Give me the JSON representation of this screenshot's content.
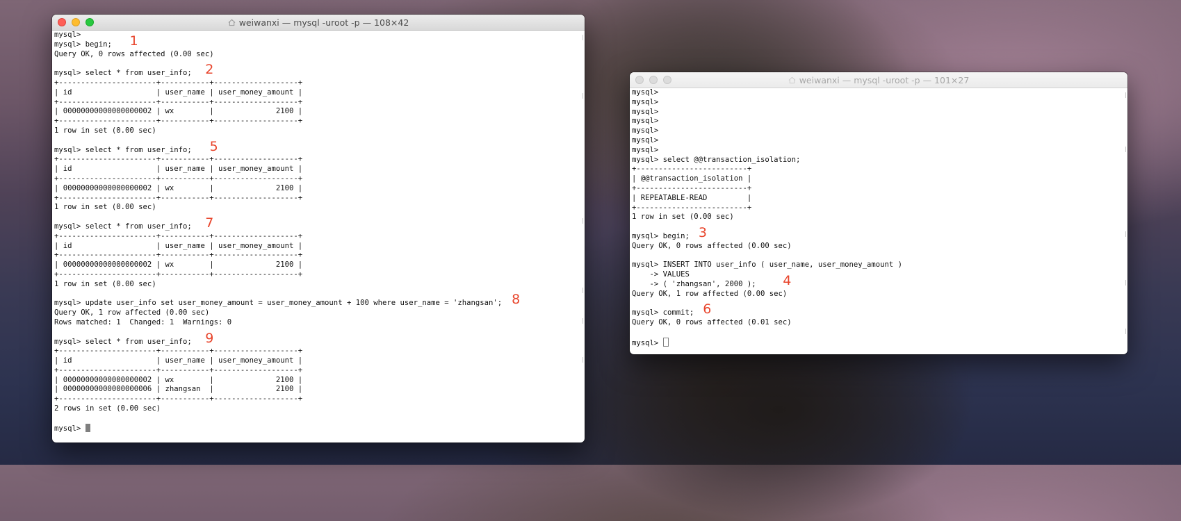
{
  "window_left": {
    "title": "weiwanxi — mysql -uroot -p — 108×42",
    "lines": [
      {
        "text": "mysql>"
      },
      {
        "text": "mysql> begin;",
        "mark": "1",
        "mark_col": 17
      },
      {
        "text": "Query OK, 0 rows affected (0.00 sec)"
      },
      {
        "text": ""
      },
      {
        "text": "mysql> select * from user_info;",
        "mark": "2",
        "mark_col": 34
      },
      {
        "text": "+----------------------+-----------+-------------------+"
      },
      {
        "text": "| id                   | user_name | user_money_amount |"
      },
      {
        "text": "+----------------------+-----------+-------------------+"
      },
      {
        "text": "| 00000000000000000002 | wx        |              2100 |"
      },
      {
        "text": "+----------------------+-----------+-------------------+"
      },
      {
        "text": "1 row in set (0.00 sec)"
      },
      {
        "text": ""
      },
      {
        "text": "mysql> select * from user_info;",
        "mark": "5",
        "mark_col": 35
      },
      {
        "text": "+----------------------+-----------+-------------------+"
      },
      {
        "text": "| id                   | user_name | user_money_amount |"
      },
      {
        "text": "+----------------------+-----------+-------------------+"
      },
      {
        "text": "| 00000000000000000002 | wx        |              2100 |"
      },
      {
        "text": "+----------------------+-----------+-------------------+"
      },
      {
        "text": "1 row in set (0.00 sec)"
      },
      {
        "text": ""
      },
      {
        "text": "mysql> select * from user_info;",
        "mark": "7",
        "mark_col": 34
      },
      {
        "text": "+----------------------+-----------+-------------------+"
      },
      {
        "text": "| id                   | user_name | user_money_amount |"
      },
      {
        "text": "+----------------------+-----------+-------------------+"
      },
      {
        "text": "| 00000000000000000002 | wx        |              2100 |"
      },
      {
        "text": "+----------------------+-----------+-------------------+"
      },
      {
        "text": "1 row in set (0.00 sec)"
      },
      {
        "text": ""
      },
      {
        "text": "mysql> update user_info set user_money_amount = user_money_amount + 100 where user_name = 'zhangsan';",
        "mark": "8",
        "mark_col": 103
      },
      {
        "text": "Query OK, 1 row affected (0.00 sec)"
      },
      {
        "text": "Rows matched: 1  Changed: 1  Warnings: 0"
      },
      {
        "text": ""
      },
      {
        "text": "mysql> select * from user_info;",
        "mark": "9",
        "mark_col": 34
      },
      {
        "text": "+----------------------+-----------+-------------------+"
      },
      {
        "text": "| id                   | user_name | user_money_amount |"
      },
      {
        "text": "+----------------------+-----------+-------------------+"
      },
      {
        "text": "| 00000000000000000002 | wx        |              2100 |"
      },
      {
        "text": "| 00000000000000000006 | zhangsan  |              2100 |"
      },
      {
        "text": "+----------------------+-----------+-------------------+"
      },
      {
        "text": "2 rows in set (0.00 sec)"
      },
      {
        "text": ""
      }
    ],
    "prompt": "mysql> "
  },
  "window_right": {
    "title": "weiwanxi — mysql -uroot -p — 101×27",
    "lines": [
      {
        "text": "mysql>"
      },
      {
        "text": "mysql>"
      },
      {
        "text": "mysql>"
      },
      {
        "text": "mysql>"
      },
      {
        "text": "mysql>"
      },
      {
        "text": "mysql>"
      },
      {
        "text": "mysql>"
      },
      {
        "text": "mysql> select @@transaction_isolation;"
      },
      {
        "text": "+-------------------------+"
      },
      {
        "text": "| @@transaction_isolation |"
      },
      {
        "text": "+-------------------------+"
      },
      {
        "text": "| REPEATABLE-READ         |"
      },
      {
        "text": "+-------------------------+"
      },
      {
        "text": "1 row in set (0.00 sec)"
      },
      {
        "text": ""
      },
      {
        "text": "mysql> begin;",
        "mark": "3",
        "mark_col": 15
      },
      {
        "text": "Query OK, 0 rows affected (0.00 sec)"
      },
      {
        "text": ""
      },
      {
        "text": "mysql> INSERT INTO user_info ( user_name, user_money_amount )"
      },
      {
        "text": "    -> VALUES"
      },
      {
        "text": "    -> ( 'zhangsan', 2000 );",
        "mark": "4",
        "mark_col": 34
      },
      {
        "text": "Query OK, 1 row affected (0.00 sec)"
      },
      {
        "text": ""
      },
      {
        "text": "mysql> commit;",
        "mark": "6",
        "mark_col": 16
      },
      {
        "text": "Query OK, 0 rows affected (0.01 sec)"
      },
      {
        "text": ""
      }
    ],
    "prompt": "mysql> "
  }
}
